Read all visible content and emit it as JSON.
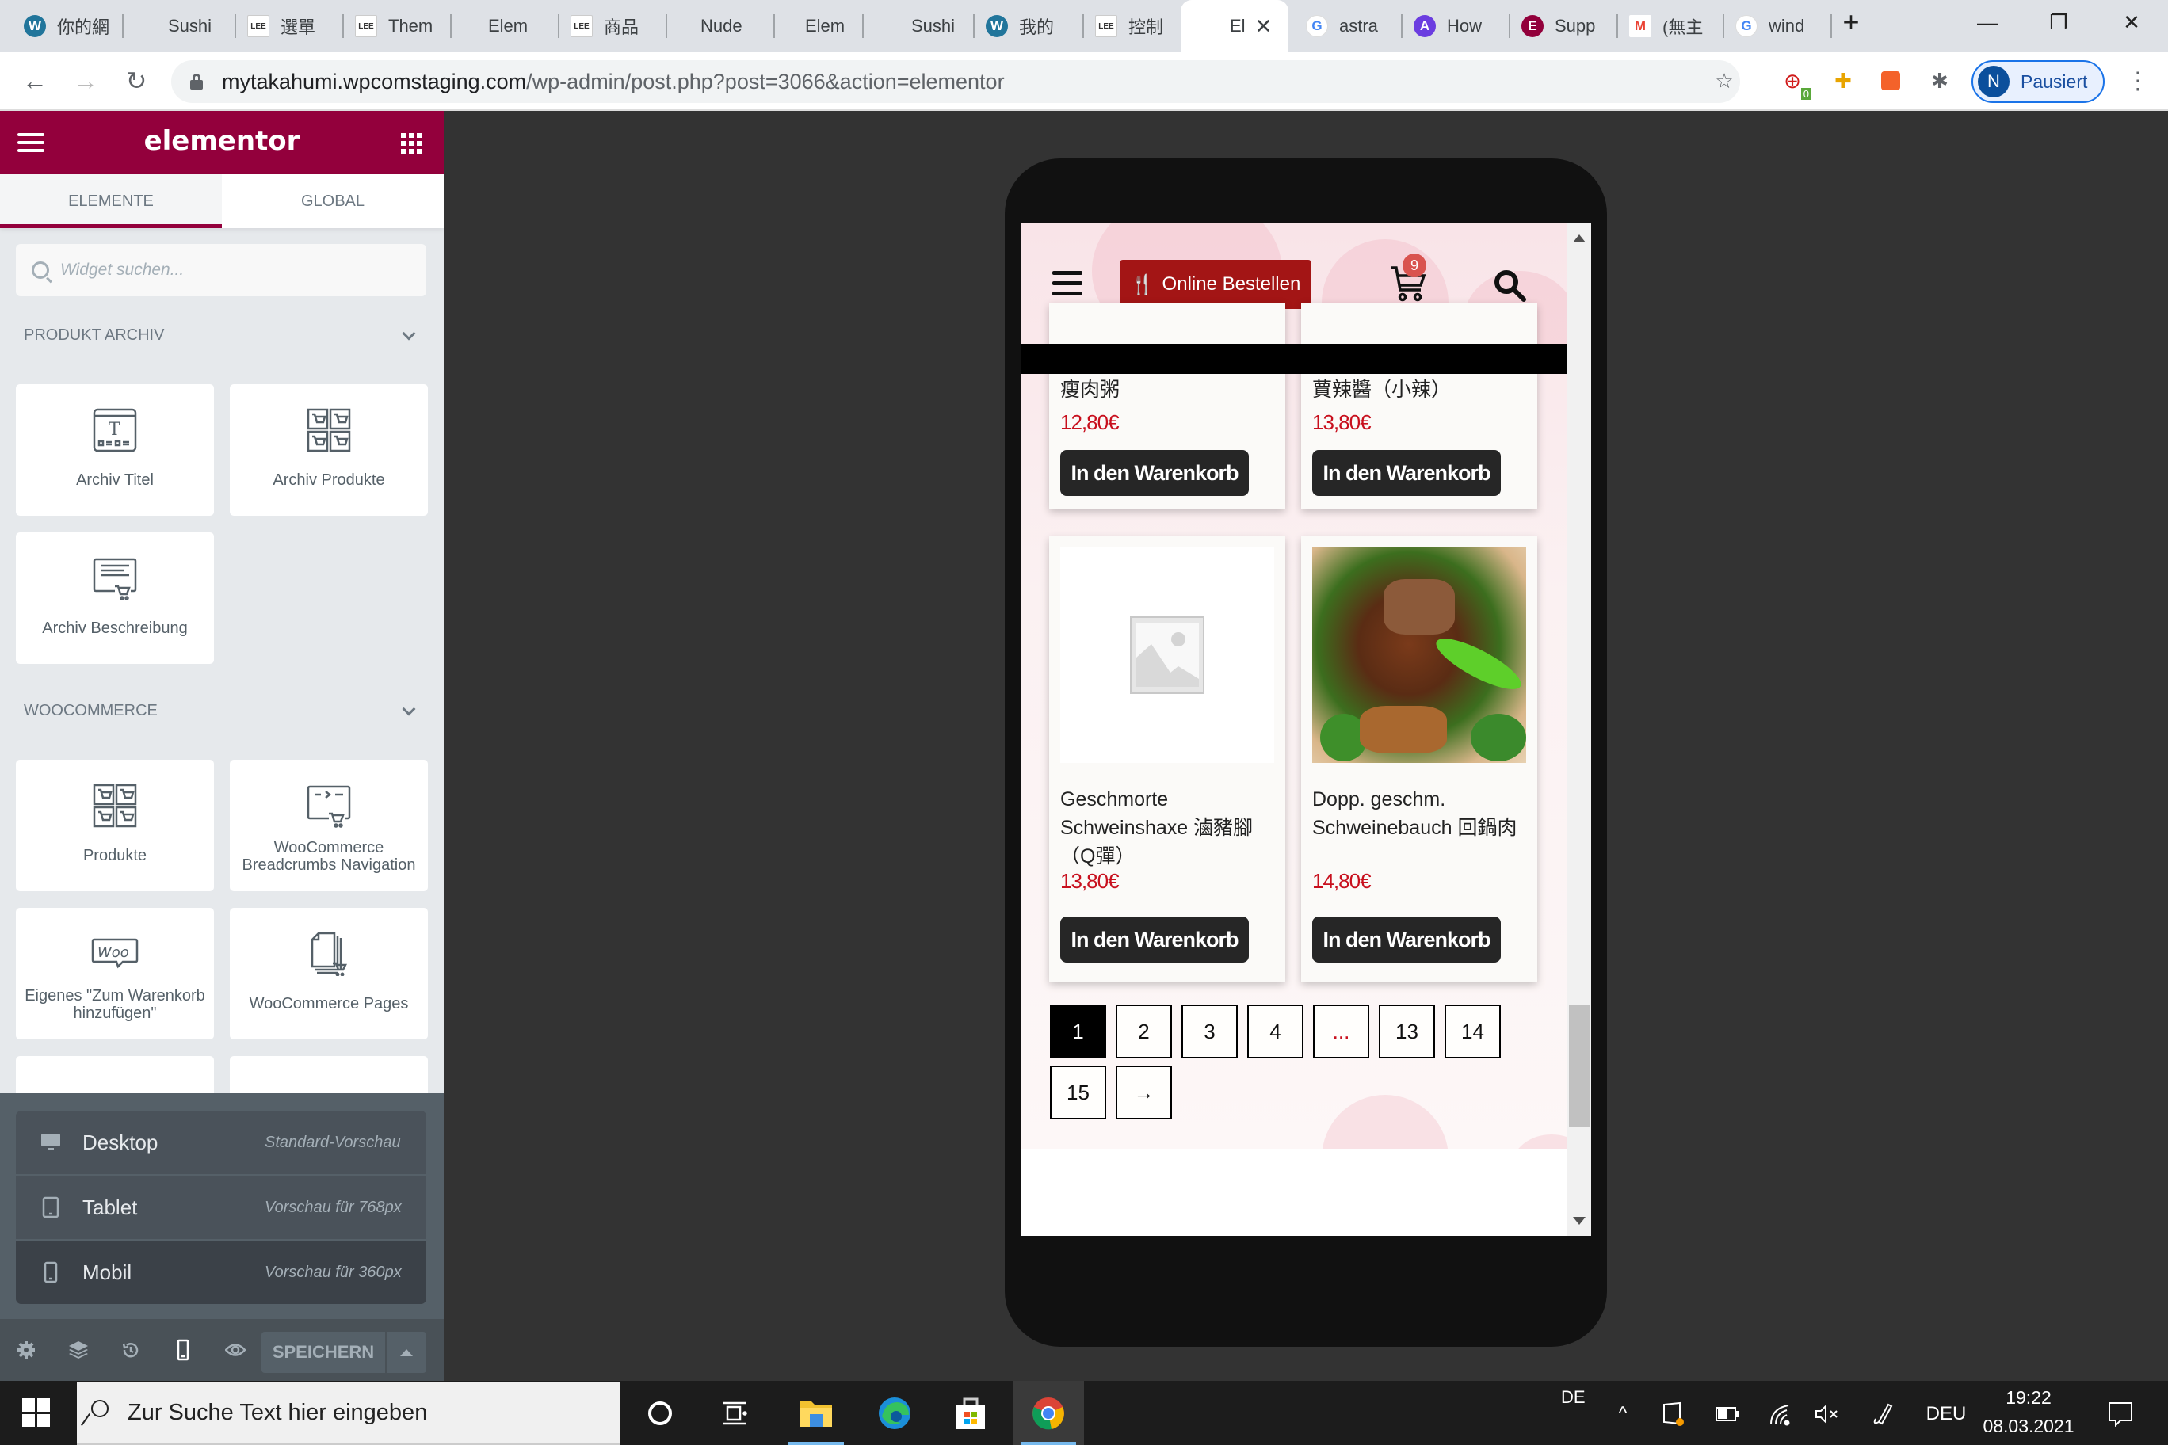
{
  "browser": {
    "tabs": [
      {
        "label": "你的網",
        "icon": "wordpress-icon"
      },
      {
        "label": "Sushi",
        "icon": "none"
      },
      {
        "label": "選單",
        "icon": "sushi-lee-icon"
      },
      {
        "label": "Them",
        "icon": "sushi-lee-icon"
      },
      {
        "label": "Elem",
        "icon": "none"
      },
      {
        "label": "商品",
        "icon": "sushi-lee-icon"
      },
      {
        "label": "Nude",
        "icon": "none"
      },
      {
        "label": "Elem",
        "icon": "none"
      },
      {
        "label": "Sushi",
        "icon": "none"
      },
      {
        "label": "我的",
        "icon": "wordpress-icon"
      },
      {
        "label": "控制",
        "icon": "sushi-lee-icon"
      },
      {
        "label": "El",
        "icon": "none",
        "active": true
      },
      {
        "label": "astra",
        "icon": "google-icon"
      },
      {
        "label": "How",
        "icon": "astra-icon"
      },
      {
        "label": "Supp",
        "icon": "elementor-icon"
      },
      {
        "label": "(無主",
        "icon": "gmail-icon"
      },
      {
        "label": "wind",
        "icon": "google-icon"
      }
    ],
    "new_tab": "+",
    "url_host": "mytakahumi.wpcomstaging.com",
    "url_path": "/wp-admin/post.php?post=3066&action=elementor",
    "extension_badge": "0",
    "profile_initial": "N",
    "profile_label": "Pausiert"
  },
  "panel": {
    "logo": "elementor",
    "tabs": [
      {
        "label": "Elemente",
        "active": true
      },
      {
        "label": "Global",
        "active": false
      }
    ],
    "search_placeholder": "Widget suchen...",
    "categories": [
      {
        "title": "Produkt Archiv",
        "widgets": [
          {
            "label": "Archiv Titel",
            "icon": "archive-title-icon"
          },
          {
            "label": "Archiv Produkte",
            "icon": "archive-products-icon"
          },
          {
            "label": "Archiv Beschreibung",
            "icon": "archive-description-icon"
          }
        ]
      },
      {
        "title": "WooCommerce",
        "widgets": [
          {
            "label": "Produkte",
            "icon": "products-icon"
          },
          {
            "label": "WooCommerce Breadcrumbs Navigation",
            "icon": "breadcrumbs-icon"
          },
          {
            "label": "Eigenes \"Zum Warenkorb hinzufügen\"",
            "icon": "woo-icon"
          },
          {
            "label": "WooCommerce Pages",
            "icon": "woo-pages-icon"
          }
        ]
      }
    ],
    "responsive": [
      {
        "label": "Desktop",
        "desc": "Standard-Vorschau",
        "icon": "desktop-icon"
      },
      {
        "label": "Tablet",
        "desc": "Vorschau für 768px",
        "icon": "tablet-icon"
      },
      {
        "label": "Mobil",
        "desc": "Vorschau für 360px",
        "icon": "mobile-icon",
        "selected": true
      }
    ],
    "save_label": "Speichern"
  },
  "preview": {
    "order_button": "Online Bestellen",
    "cart_count": "9",
    "products": [
      {
        "title": "瘦肉粥",
        "price": "12,80€",
        "button": "In den Warenkorb",
        "image": "none"
      },
      {
        "title": "蕒辣醬（小辣）",
        "price": "13,80€",
        "button": "In den Warenkorb",
        "image": "none"
      },
      {
        "title": "Geschmorte Schweinshaxe 滷豬腳（Q彈）",
        "price": "13,80€",
        "button": "In den Warenkorb",
        "image": "placeholder"
      },
      {
        "title": "Dopp. geschm. Schweinebauch 回鍋肉",
        "price": "14,80€",
        "button": "In den Warenkorb",
        "image": "food-photo"
      }
    ],
    "pagination": {
      "pages": [
        "1",
        "2",
        "3",
        "4",
        "...",
        "13",
        "14",
        "15",
        "→"
      ],
      "current": "1"
    }
  },
  "taskbar": {
    "search_placeholder": "Zur Suche Text hier eingeben",
    "ime": "DE",
    "lang": "DEU",
    "time": "19:22",
    "date": "08.03.2021"
  }
}
